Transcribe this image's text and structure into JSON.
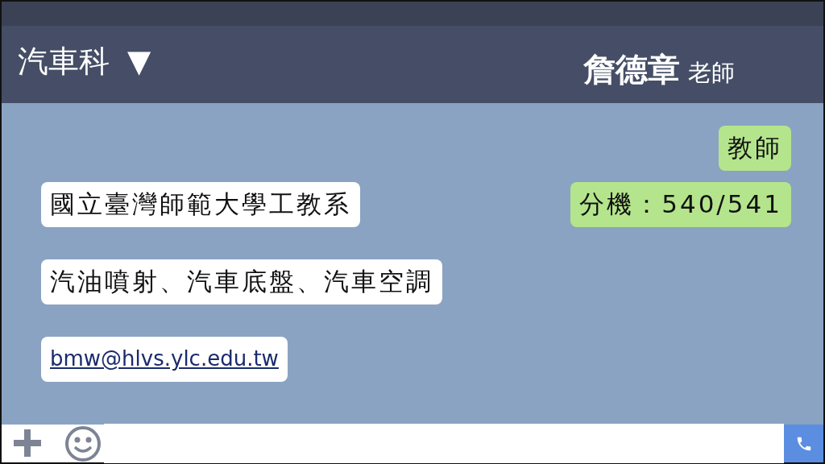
{
  "header": {
    "department": "汽車科",
    "dropdown": "▼",
    "name": "詹德章",
    "title": "老師"
  },
  "rows": [
    {
      "messages": [
        {
          "text": "教師",
          "kind": "outgoing"
        }
      ]
    },
    {
      "messages": [
        {
          "text": "國立臺灣師範大學工教系",
          "kind": "incoming"
        },
        {
          "text": "分機：540/541",
          "kind": "outgoing"
        }
      ]
    },
    {
      "messages": [
        {
          "text": "汽油噴射、汽車底盤、汽車空調",
          "kind": "incoming"
        }
      ]
    },
    {
      "messages": [
        {
          "text": "bmw@hlvs.ylc.edu.tw",
          "kind": "link"
        }
      ]
    }
  ]
}
